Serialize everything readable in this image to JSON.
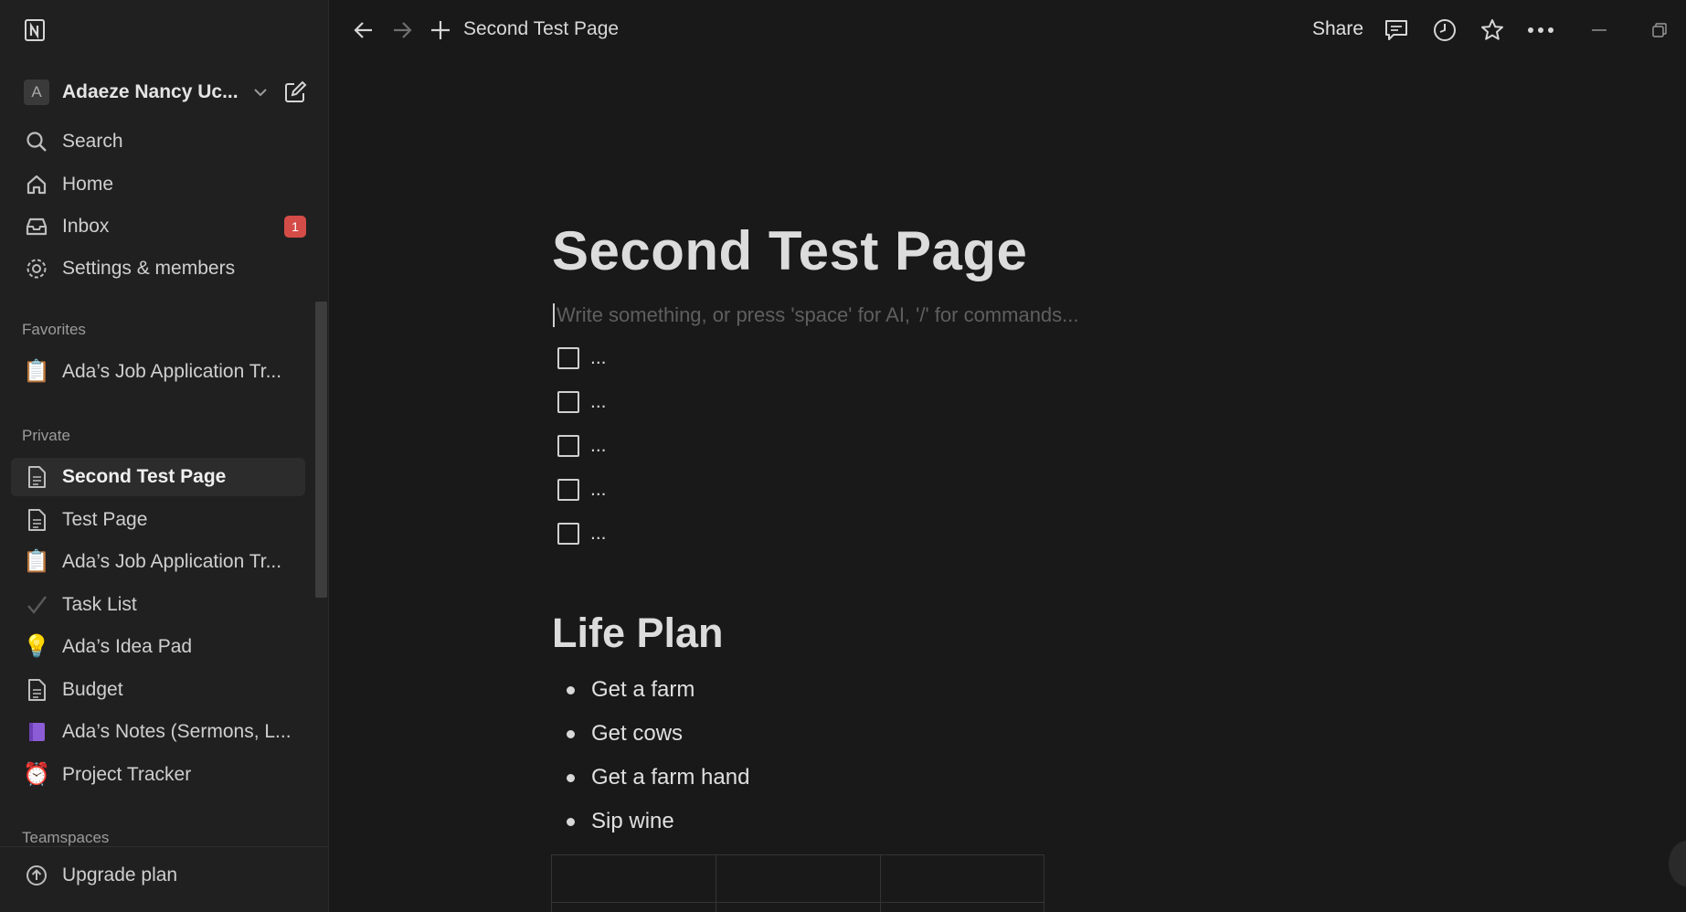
{
  "sidebar": {
    "workspace": {
      "avatar_letter": "A",
      "name": "Adaeze Nancy Uc..."
    },
    "nav": {
      "search": "Search",
      "home": "Home",
      "inbox": "Inbox",
      "inbox_badge": "1",
      "settings": "Settings & members"
    },
    "favorites_label": "Favorites",
    "favorites": [
      {
        "label": "Ada’s Job Application Tr...",
        "icon": "clipboard-icon"
      }
    ],
    "private_label": "Private",
    "private": [
      {
        "label": "Second Test Page",
        "icon": "page-icon"
      },
      {
        "label": "Test Page",
        "icon": "page-icon"
      },
      {
        "label": "Ada’s Job Application Tr...",
        "icon": "clipboard-icon"
      },
      {
        "label": "Task List",
        "icon": "checkmark-icon"
      },
      {
        "label": "Ada’s Idea Pad",
        "icon": "lightbulb-icon"
      },
      {
        "label": "Budget",
        "icon": "page-icon"
      },
      {
        "label": "Ada’s Notes (Sermons, L...",
        "icon": "purple-book-icon"
      },
      {
        "label": "Project Tracker",
        "icon": "alarm-clock-icon"
      }
    ],
    "teamspaces_label": "Teamspaces",
    "upgrade": "Upgrade plan"
  },
  "topbar": {
    "title": "Second Test Page",
    "share": "Share"
  },
  "page": {
    "title": "Second Test Page",
    "placeholder": "Write something, or press 'space' for AI, '/' for commands...",
    "todos": [
      "...",
      "...",
      "...",
      "...",
      "..."
    ],
    "heading": "Life Plan",
    "bullets": [
      "Get a farm",
      "Get cows",
      "Get a farm hand",
      "Sip wine"
    ]
  },
  "colors": {
    "background": "#191919",
    "sidebar": "#202020",
    "badge": "#d44c47"
  }
}
